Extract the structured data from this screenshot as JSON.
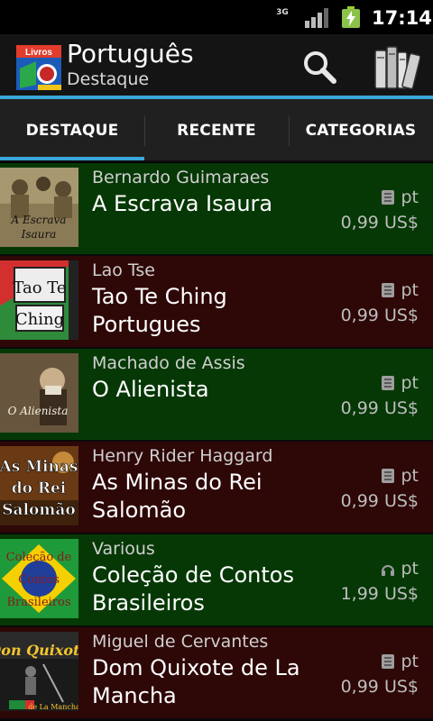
{
  "status_bar": {
    "network": "3G",
    "time": "17:14"
  },
  "header": {
    "logo_text": "Livros",
    "title": "Português",
    "subtitle": "Destaque"
  },
  "tabs": [
    {
      "label": "DESTAQUE",
      "selected": true
    },
    {
      "label": "RECENTE",
      "selected": false
    },
    {
      "label": "CATEGORIAS",
      "selected": false
    }
  ],
  "books": [
    {
      "author": "Bernardo Guimaraes",
      "title": "A Escrava Isaura",
      "lang": "pt",
      "price": "0,99 US$",
      "format_icon": "book-icon",
      "cover_text": "A Escrava Isaura",
      "color": "#063806"
    },
    {
      "author": "Lao Tse",
      "title": "Tao Te Ching Portugues",
      "lang": "pt",
      "price": "0,99 US$",
      "format_icon": "book-icon",
      "cover_text": "Tao Te Ching",
      "color": "#2e0707"
    },
    {
      "author": "Machado de Assis",
      "title": "O Alienista",
      "lang": "pt",
      "price": "0,99 US$",
      "format_icon": "book-icon",
      "cover_text": "O Alienista",
      "color": "#063806"
    },
    {
      "author": "Henry Rider Haggard",
      "title": "As Minas do Rei Salomão",
      "lang": "pt",
      "price": "0,99 US$",
      "format_icon": "book-icon",
      "cover_text": "As Minas do Rei Salomão",
      "color": "#2e0707"
    },
    {
      "author": "Various",
      "title": "Coleção de Contos Brasileiros",
      "lang": "pt",
      "price": "1,99 US$",
      "format_icon": "headphones-icon",
      "cover_text": "Coleção de Contos Brasileiros",
      "color": "#063806"
    },
    {
      "author": "Miguel de Cervantes",
      "title": "Dom Quixote de La Mancha",
      "lang": "pt",
      "price": "0,99 US$",
      "format_icon": "book-icon",
      "cover_text": "Dom Quixote de La Mancha",
      "color": "#2e0707"
    }
  ],
  "colors": {
    "accent": "#3aa8d8",
    "row_green": "#063806",
    "row_red": "#2e0707"
  }
}
